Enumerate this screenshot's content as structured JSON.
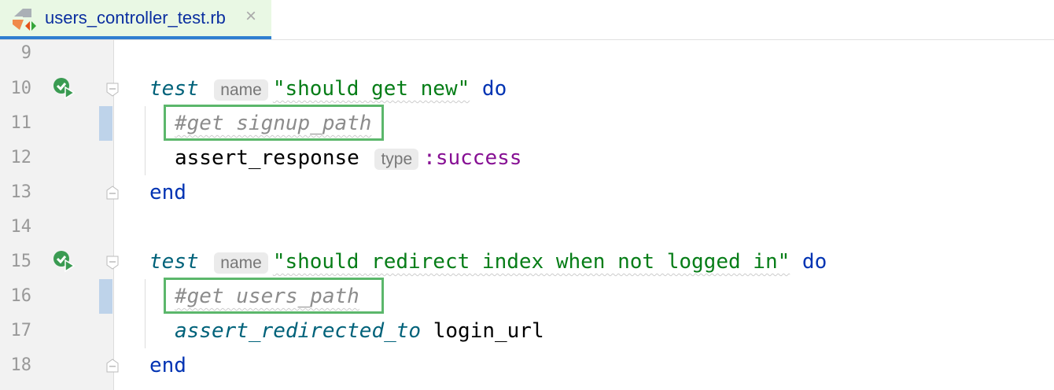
{
  "tab": {
    "filename": "users_controller_test.rb",
    "close": "×"
  },
  "colors": {
    "accent": "#2f7fd0",
    "highlight_box": "#5bb76b",
    "tab_bg": "#e9f8e4"
  },
  "lines": [
    {
      "n": "9"
    },
    {
      "n": "10",
      "kw": "test",
      "hint": "name",
      "str": "\"should get new\"",
      "do": "do"
    },
    {
      "n": "11",
      "comment": "#get signup_path"
    },
    {
      "n": "12",
      "method": "assert_response",
      "hint": "type",
      "sym": ":success"
    },
    {
      "n": "13",
      "end": "end"
    },
    {
      "n": "14"
    },
    {
      "n": "15",
      "kw": "test",
      "hint": "name",
      "str": "\"should redirect index when not logged in\"",
      "do": "do"
    },
    {
      "n": "16",
      "comment": "#get users_path"
    },
    {
      "n": "17",
      "method": "assert_redirected_to",
      "arg": "login_url"
    },
    {
      "n": "18",
      "end": "end"
    }
  ]
}
